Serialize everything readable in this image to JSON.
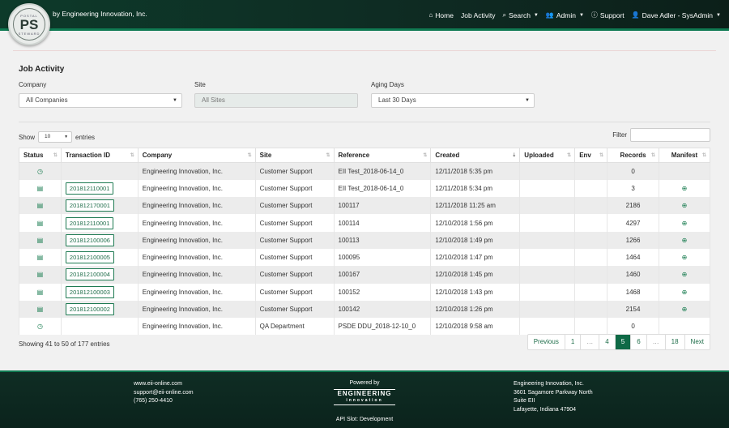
{
  "header": {
    "logo": {
      "top_text": "POSTAL",
      "main_text": "PS",
      "bottom_text": "STEWARD"
    },
    "brand": "by Engineering Innovation, Inc.",
    "nav": [
      {
        "label": "Home",
        "icon": "home-icon"
      },
      {
        "label": "Job Activity",
        "icon": ""
      },
      {
        "label": "Search",
        "icon": "search-icon",
        "dropdown": true
      },
      {
        "label": "Admin",
        "icon": "users-icon",
        "dropdown": true
      },
      {
        "label": "Support",
        "icon": "help-icon"
      },
      {
        "label": "Dave Adler - SysAdmin",
        "icon": "user-icon",
        "dropdown": true
      }
    ]
  },
  "page": {
    "title": "Job Activity",
    "filters": {
      "company_label": "Company",
      "company_value": "All Companies",
      "site_label": "Site",
      "site_value": "All Sites",
      "aging_label": "Aging Days",
      "aging_value": "Last 30 Days"
    },
    "show_label": "Show",
    "show_value": "10",
    "entries_label": "entries",
    "filter_label": "Filter"
  },
  "table": {
    "columns": [
      "Status",
      "Transaction ID",
      "Company",
      "Site",
      "Reference",
      "Created",
      "Uploaded",
      "Env",
      "Records",
      "Manifest"
    ],
    "rows": [
      {
        "status": "clock",
        "tid": "",
        "company": "Engineering Innovation, Inc.",
        "site": "Customer Support",
        "reference": "EII Test_2018-06-14_0",
        "created": "12/11/2018 5:35 pm",
        "uploaded": "",
        "env": "",
        "records": "0",
        "manifest": false
      },
      {
        "status": "doc",
        "tid": "201812110001",
        "company": "Engineering Innovation, Inc.",
        "site": "Customer Support",
        "reference": "EII Test_2018-06-14_0",
        "created": "12/11/2018 5:34 pm",
        "uploaded": "",
        "env": "",
        "records": "3",
        "manifest": true
      },
      {
        "status": "doc",
        "tid": "201812170001",
        "company": "Engineering Innovation, Inc.",
        "site": "Customer Support",
        "reference": "100117",
        "created": "12/11/2018 11:25 am",
        "uploaded": "",
        "env": "",
        "records": "2186",
        "manifest": true
      },
      {
        "status": "doc",
        "tid": "201812110001",
        "company": "Engineering Innovation, Inc.",
        "site": "Customer Support",
        "reference": "100114",
        "created": "12/10/2018 1:56 pm",
        "uploaded": "",
        "env": "",
        "records": "4297",
        "manifest": true
      },
      {
        "status": "doc",
        "tid": "201812100006",
        "company": "Engineering Innovation, Inc.",
        "site": "Customer Support",
        "reference": "100113",
        "created": "12/10/2018 1:49 pm",
        "uploaded": "",
        "env": "",
        "records": "1266",
        "manifest": true
      },
      {
        "status": "doc",
        "tid": "201812100005",
        "company": "Engineering Innovation, Inc.",
        "site": "Customer Support",
        "reference": "100095",
        "created": "12/10/2018 1:47 pm",
        "uploaded": "",
        "env": "",
        "records": "1464",
        "manifest": true
      },
      {
        "status": "doc",
        "tid": "201812100004",
        "company": "Engineering Innovation, Inc.",
        "site": "Customer Support",
        "reference": "100167",
        "created": "12/10/2018 1:45 pm",
        "uploaded": "",
        "env": "",
        "records": "1460",
        "manifest": true
      },
      {
        "status": "doc",
        "tid": "201812100003",
        "company": "Engineering Innovation, Inc.",
        "site": "Customer Support",
        "reference": "100152",
        "created": "12/10/2018 1:43 pm",
        "uploaded": "",
        "env": "",
        "records": "1468",
        "manifest": true
      },
      {
        "status": "doc",
        "tid": "201812100002",
        "company": "Engineering Innovation, Inc.",
        "site": "Customer Support",
        "reference": "100142",
        "created": "12/10/2018 1:26 pm",
        "uploaded": "",
        "env": "",
        "records": "2154",
        "manifest": true
      },
      {
        "status": "clock",
        "tid": "",
        "company": "Engineering Innovation, Inc.",
        "site": "QA Department",
        "reference": "PSDE DDU_2018-12-10_0",
        "created": "12/10/2018 9:58 am",
        "uploaded": "",
        "env": "",
        "records": "0",
        "manifest": false
      }
    ]
  },
  "pagination": {
    "info": "Showing 41 to 50 of 177 entries",
    "pages": [
      {
        "label": "Previous",
        "state": "link"
      },
      {
        "label": "1",
        "state": "link"
      },
      {
        "label": "…",
        "state": "ellip"
      },
      {
        "label": "4",
        "state": "link"
      },
      {
        "label": "5",
        "state": "active"
      },
      {
        "label": "6",
        "state": "link"
      },
      {
        "label": "…",
        "state": "ellip"
      },
      {
        "label": "18",
        "state": "link"
      },
      {
        "label": "Next",
        "state": "link"
      }
    ]
  },
  "footer": {
    "contact": [
      "www.eii-online.com",
      "support@eii-online.com",
      "(765) 250-4410"
    ],
    "powered_by": "Powered by",
    "eng_logo_main": "ENGINEERING",
    "eng_logo_sub": "innovation",
    "api_slot": "API Slot: Development",
    "address": [
      "Engineering Innovation, Inc.",
      "3601 Sagamore Parkway North",
      "Suite EII",
      "Lafayette, Indiana 47904"
    ]
  },
  "colors": {
    "primary": "#0f6a46",
    "header_bg": "#0d3a2a",
    "stripe": "#0f7a52"
  }
}
